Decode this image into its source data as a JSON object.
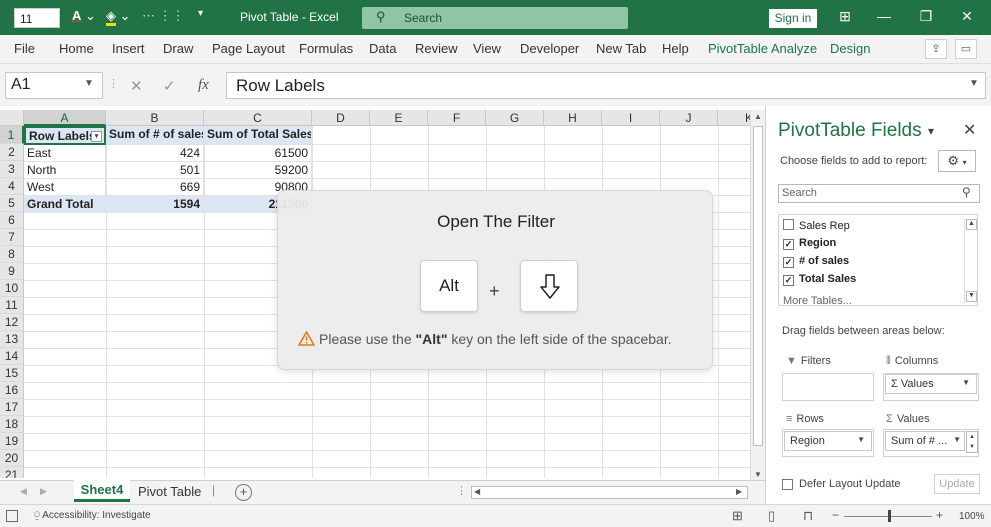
{
  "app": {
    "font_size": "11",
    "doc_title": "Pivot Table - Excel",
    "search_label": "Search",
    "sign_in": "Sign in"
  },
  "ribbon": {
    "tabs": [
      "File",
      "Home",
      "Insert",
      "Draw",
      "Page Layout",
      "Formulas",
      "Data",
      "Review",
      "View",
      "Developer",
      "New Tab",
      "Help",
      "PivotTable Analyze",
      "Design"
    ]
  },
  "formula": {
    "cell_ref": "A1",
    "fx": "fx",
    "content": "Row Labels"
  },
  "grid": {
    "columns": [
      "A",
      "B",
      "C",
      "D",
      "E",
      "F",
      "G",
      "H",
      "I",
      "J",
      "K"
    ],
    "rows": [
      "1",
      "2",
      "3",
      "4",
      "5",
      "6",
      "7",
      "8",
      "9",
      "10",
      "11",
      "12",
      "13",
      "14",
      "15",
      "16",
      "17",
      "18",
      "19",
      "20",
      "21"
    ],
    "header": [
      "Row Labels",
      "Sum of # of sales",
      "Sum of Total Sales"
    ],
    "data": [
      [
        "East",
        "424",
        "61500"
      ],
      [
        "North",
        "501",
        "59200"
      ],
      [
        "West",
        "669",
        "90800"
      ]
    ],
    "total": [
      "Grand Total",
      "1594",
      "211500"
    ]
  },
  "sheets": {
    "active": "Sheet4",
    "other": "Pivot Table",
    "add": "+"
  },
  "status": {
    "accessibility": "Accessibility: Investigate",
    "zoom": "100%"
  },
  "pivot_pane": {
    "title": "PivotTable Fields",
    "choose_label": "Choose fields to add to report:",
    "search_placeholder": "Search",
    "fields": [
      {
        "label": "Sales Rep",
        "checked": false
      },
      {
        "label": "Region",
        "checked": true
      },
      {
        "label": "# of sales",
        "checked": true
      },
      {
        "label": "Total Sales",
        "checked": true
      },
      {
        "label": "More Tables...",
        "checked": null
      }
    ],
    "drag_label": "Drag fields between areas below:",
    "areas": {
      "filters": "Filters",
      "columns": "Columns",
      "rows": "Rows",
      "values": "Values",
      "columns_item": "Σ Values",
      "rows_item": "Region",
      "values_item": "Sum of # ..."
    },
    "defer_label": "Defer Layout Update",
    "update_label": "Update"
  },
  "overlay": {
    "title": "Open The Filter",
    "key1": "Alt",
    "plus": "+",
    "key2_icon": "arrow-down-icon",
    "msg_pre": "Please use the ",
    "msg_key": "\"Alt\"",
    "msg_post": " key on the left side of the spacebar."
  }
}
